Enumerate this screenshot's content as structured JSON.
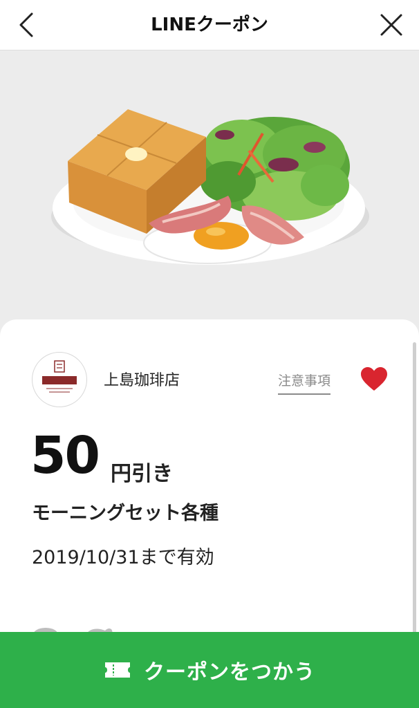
{
  "header": {
    "title": "LINEクーポン"
  },
  "store": {
    "name": "上島珈琲店",
    "notes_label": "注意事項"
  },
  "coupon": {
    "discount_value": "50",
    "discount_unit": "円引き",
    "title": "モーニングセット各種",
    "valid_until": "2019/10/31まで有効"
  },
  "cta": {
    "label": "クーポンをつかう"
  },
  "colors": {
    "accent_green": "#2eb04a",
    "favorite_red": "#d9252f"
  },
  "icons": [
    "chevron-left-icon",
    "close-icon",
    "heart-icon",
    "ticket-icon"
  ]
}
